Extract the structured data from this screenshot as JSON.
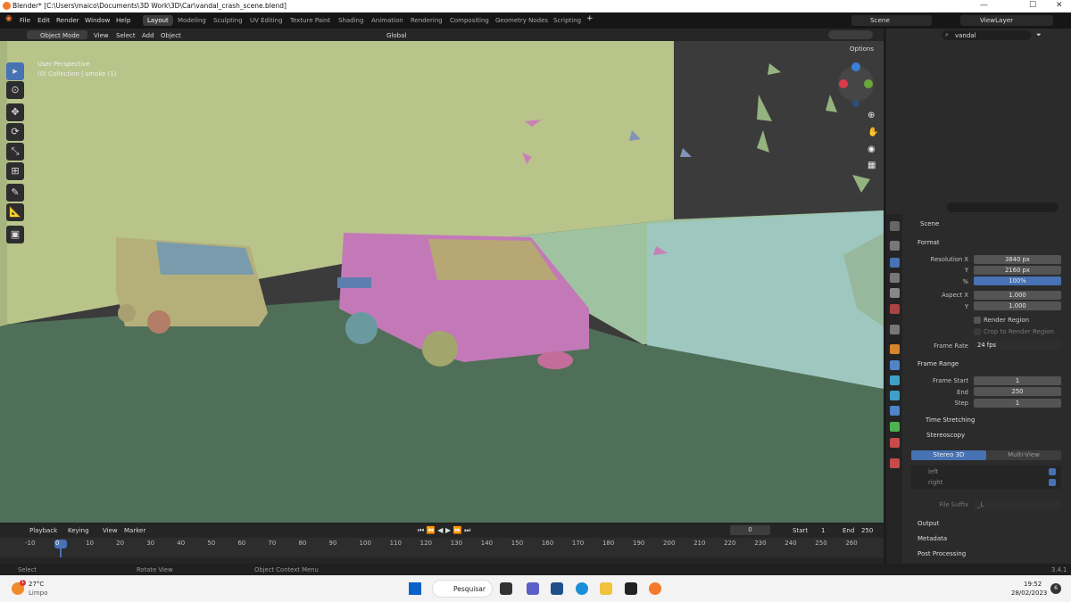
{
  "titlebar": {
    "title": "Blender* [C:\\Users\\maico\\Documents\\3D Work\\3D\\Car\\vandal_crash_scene.blend]",
    "min": "—",
    "max": "☐",
    "close": "✕"
  },
  "menu": {
    "file": "File",
    "edit": "Edit",
    "render": "Render",
    "window": "Window",
    "help": "Help"
  },
  "workspaces": [
    "Layout",
    "Modeling",
    "Sculpting",
    "UV Editing",
    "Texture Paint",
    "Shading",
    "Animation",
    "Rendering",
    "Compositing",
    "Geometry Nodes",
    "Scripting"
  ],
  "add_ws": "+",
  "scene_name": "Scene",
  "view_layer": "ViewLayer",
  "viewport_header": {
    "mode": "Object Mode",
    "view": "View",
    "select": "Select",
    "add": "Add",
    "object": "Object",
    "orientation": "Global",
    "options": "Options"
  },
  "viewport": {
    "perspective": "User Perspective",
    "collection": "(0) Collection | smoke (1)"
  },
  "outliner": {
    "search": "vandal"
  },
  "props": {
    "scene": "Scene",
    "format": "Format",
    "resolution_x_label": "Resolution X",
    "resolution_x": "3840 px",
    "y_label": "Y",
    "resolution_y": "2160 px",
    "pct_label": "%",
    "pct": "100%",
    "aspect_x_label": "Aspect X",
    "aspect_x": "1.000",
    "aspect_y_label": "Y",
    "aspect_y": "1.000",
    "render_region": "Render Region",
    "crop_region": "Crop to Render Region",
    "frame_rate_label": "Frame Rate",
    "frame_rate": "24 fps",
    "frame_range": "Frame Range",
    "frame_start_label": "Frame Start",
    "frame_start": "1",
    "end_label": "End",
    "frame_end": "250",
    "step_label": "Step",
    "frame_step": "1",
    "time_stretching": "Time Stretching",
    "stereoscopy": "Stereoscopy",
    "stereo3d": "Stereo 3D",
    "multiview": "Multi-View",
    "left": "left",
    "right": "right",
    "file_suffix_label": "File Suffix",
    "file_suffix": "_L",
    "output": "Output",
    "metadata": "Metadata",
    "post_processing": "Post Processing"
  },
  "timeline": {
    "playback": "Playback",
    "keying": "Keying",
    "view": "View",
    "marker": "Marker",
    "current": "0",
    "start_label": "Start",
    "start": "1",
    "end_label": "End",
    "end": "250",
    "ticks": [
      "-10",
      "0",
      "10",
      "20",
      "30",
      "40",
      "50",
      "60",
      "70",
      "80",
      "90",
      "100",
      "110",
      "120",
      "130",
      "140",
      "150",
      "160",
      "170",
      "180",
      "190",
      "200",
      "210",
      "220",
      "230",
      "240",
      "250",
      "260"
    ]
  },
  "status": {
    "select": "Select",
    "rotate": "Rotate View",
    "context": "Object Context Menu",
    "version": "3.4.1"
  },
  "taskbar": {
    "temp": "27°C",
    "weather": "Limpo",
    "search": "Pesquisar",
    "time": "19:52",
    "date": "28/02/2023",
    "badge": "1",
    "notif": "6"
  }
}
